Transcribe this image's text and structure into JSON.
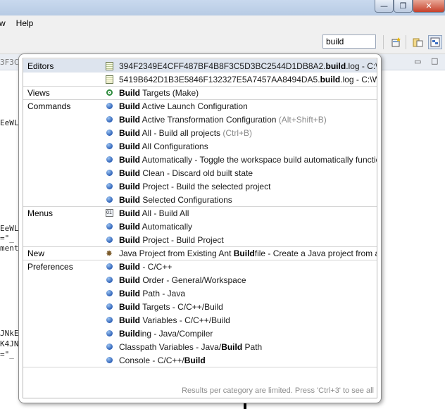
{
  "window": {
    "minimize_glyph": "—",
    "maximize_glyph": "❐",
    "close_glyph": "✕"
  },
  "menubar": {
    "items": [
      "w",
      "Help"
    ]
  },
  "toolbar": {
    "quick_access_value": "build"
  },
  "editor": {
    "tab_fragment": "3F3C",
    "code_lines": [
      "EeWL",
      "EeWL",
      "=\"_",
      "ment",
      "JNkE",
      "K4JN",
      "=\"_"
    ]
  },
  "popup": {
    "categories": {
      "editors": "Editors",
      "views": "Views",
      "commands": "Commands",
      "menus": "Menus",
      "new": "New",
      "preferences": "Preferences"
    },
    "editors": [
      {
        "pre": "394F2349E4CFF487BF4B8F3C5D3BC2544D1DB8A2.",
        "match": "build",
        "post": ".log - C:\\Workspace"
      },
      {
        "pre": "5419B642D1B3E5846F132327E5A7457AA8494DA5.",
        "match": "build",
        "post": ".log - C:\\Workspace"
      }
    ],
    "views": [
      {
        "match": "Build",
        "post": " Targets (Make)"
      }
    ],
    "commands": [
      {
        "match": "Build",
        "post": " Active Launch Configuration",
        "shortcut": ""
      },
      {
        "match": "Build",
        "post": " Active Transformation Configuration ",
        "shortcut": "(Alt+Shift+B)"
      },
      {
        "match": "Build",
        "post": " All - Build all projects ",
        "shortcut": "(Ctrl+B)"
      },
      {
        "match": "Build",
        "post": " All Configurations",
        "shortcut": ""
      },
      {
        "match": "Build",
        "post": " Automatically - Toggle the workspace build automatically function",
        "shortcut": ""
      },
      {
        "match": "Build",
        "post": " Clean - Discard old built state",
        "shortcut": ""
      },
      {
        "match": "Build",
        "post": " Project - Build the selected project",
        "shortcut": ""
      },
      {
        "match": "Build",
        "post": " Selected Configurations",
        "shortcut": ""
      }
    ],
    "menus": [
      {
        "match": "Build",
        "post": " All - Build All"
      },
      {
        "match": "Build",
        "post": " Automatically"
      },
      {
        "match": "Build",
        "post": " Project - Build Project"
      }
    ],
    "new": [
      {
        "pre": "Java Project from Existing Ant ",
        "match": "Build",
        "post": "file - Create a Java project from an"
      }
    ],
    "preferences": [
      {
        "pre": "",
        "match": "Build",
        "post": " - C/C++"
      },
      {
        "pre": "",
        "match": "Build",
        "post": " Order - General/Workspace"
      },
      {
        "pre": "",
        "match": "Build",
        "post": " Path - Java"
      },
      {
        "pre": "",
        "match": "Build",
        "post": " Targets - C/C++/Build"
      },
      {
        "pre": "",
        "match": "Build",
        "post": " Variables - C/C++/Build"
      },
      {
        "pre": "",
        "match": "Build",
        "post": "ing - Java/Compiler"
      },
      {
        "pre": "Classpath Variables - Java/",
        "match": "Build",
        "post": " Path"
      },
      {
        "pre": "Console - C/C++/",
        "match": "Build",
        "post": ""
      }
    ],
    "footer": "Results per category are limited. Press 'Ctrl+3' to see all"
  }
}
